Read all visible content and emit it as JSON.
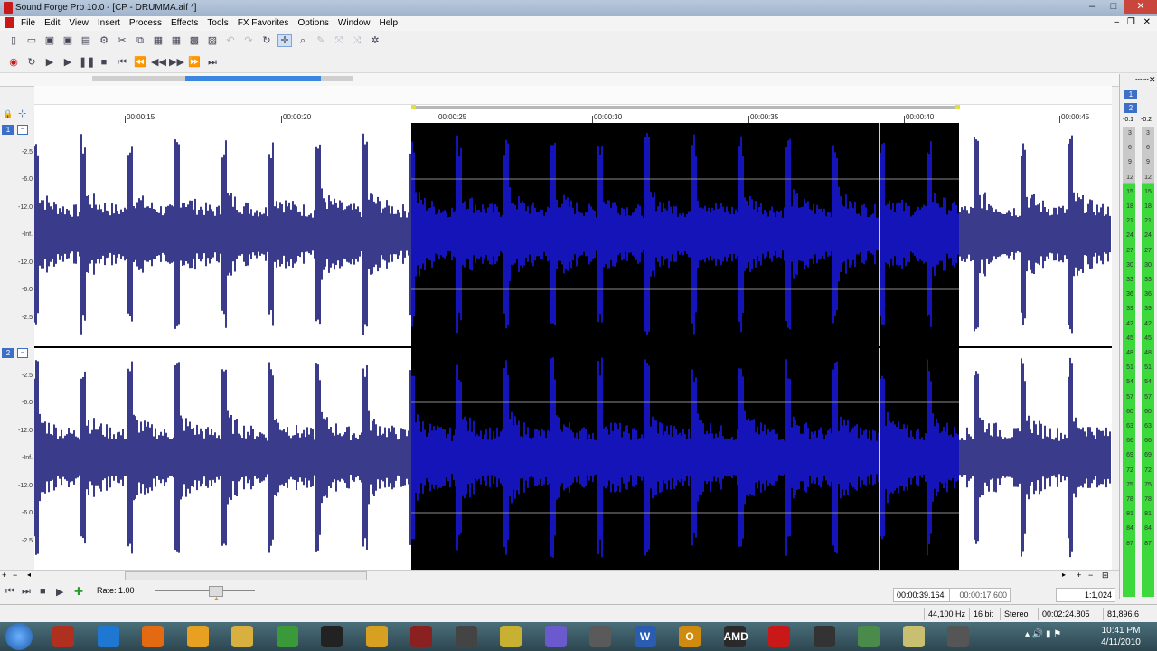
{
  "window": {
    "title": "Sound Forge Pro 10.0 - [CP - DRUMMA.aif *]",
    "controls": {
      "minimize": "–",
      "maximize": "□",
      "close": "✕",
      "restore": "❐"
    }
  },
  "menu": [
    "File",
    "Edit",
    "View",
    "Insert",
    "Process",
    "Effects",
    "Tools",
    "FX Favorites",
    "Options",
    "Window",
    "Help"
  ],
  "toolbar_icons": [
    "new-icon",
    "open-icon",
    "save-icon",
    "save-as-icon",
    "render-icon",
    "properties-icon",
    "cut-icon",
    "copy-icon",
    "paste-icon",
    "paste-special-icon",
    "mix-icon",
    "crop-icon",
    "undo-icon",
    "redo-icon",
    "repeat-icon",
    "edit-tool-icon",
    "magnify-tool-icon",
    "pencil-tool-icon",
    "envelope-tool-icon",
    "event-tool-icon",
    "plugin-chain-icon"
  ],
  "transport_icons": [
    "record-icon",
    "loop-icon",
    "play-all-icon",
    "play-icon",
    "pause-icon",
    "stop-icon",
    "go-to-start-icon",
    "previous-icon",
    "rewind-icon",
    "forward-icon",
    "next-icon",
    "go-to-end-icon"
  ],
  "ruler": {
    "ticks": [
      "00:00:15",
      "00:00:20",
      "00:00:25",
      "00:00:30",
      "00:00:35",
      "00:00:40",
      "00:00:45"
    ]
  },
  "channels": [
    {
      "badge": "1",
      "minimize": "−",
      "db_labels": [
        "-2.5",
        "-6.0",
        "-12.0",
        "-Inf.",
        "-12.0",
        "-6.0",
        "-2.5"
      ]
    },
    {
      "badge": "2",
      "minimize": "−",
      "db_labels": [
        "-2.5",
        "-6.0",
        "-12.0",
        "-Inf.",
        "-12.0",
        "-6.0",
        "-2.5"
      ]
    }
  ],
  "meter": {
    "channel_buttons": [
      "1",
      "2"
    ],
    "peaks": [
      "-0.1",
      "-0.2"
    ],
    "scale": [
      "3",
      "6",
      "9",
      "12",
      "15",
      "18",
      "21",
      "24",
      "27",
      "30",
      "33",
      "36",
      "39",
      "42",
      "45",
      "48",
      "51",
      "54",
      "57",
      "60",
      "63",
      "66",
      "69",
      "72",
      "75",
      "78",
      "81",
      "84",
      "87"
    ],
    "colors": {
      "top": "#c9c9c9",
      "green": "#3cd83c"
    }
  },
  "bottom_transport": {
    "rate_label": "Rate: 1.00"
  },
  "status_fields": {
    "cursor_position": "00:00:39.164",
    "selection_length": "00:00:17.600",
    "zoom_ratio": "1:1,024"
  },
  "statusbar": {
    "sample_rate": "44,100 Hz",
    "bit_depth": "16 bit",
    "channels": "Stereo",
    "length": "00:02:24.805",
    "disk_space": "81,896.6 MB"
  },
  "taskbar": {
    "apps": [
      "media-player-icon",
      "internet-explorer-icon",
      "firefox-icon",
      "pinwheel-app-icon",
      "explorer-folder-icon",
      "chrome-icon",
      "blackberry-icon",
      "video-player-icon",
      "soundforge-taskbar-icon",
      "ableton-icon",
      "reason-icon",
      "fl-studio-icon",
      "acid-icon",
      "word-icon",
      "outlook-icon",
      "amd-icon",
      "opera-icon",
      "audacity-icon",
      "network-icon",
      "notepad-icon",
      "wire-icon"
    ],
    "app_labels": {
      "word": "W",
      "outlook": "O",
      "amd": "AMD"
    },
    "time": "10:41 PM",
    "date": "4/11/2010"
  },
  "colors": {
    "waveform_unselected": "#0a0a6e",
    "waveform_selected": "#1a1ae6",
    "selection_background": "#000000",
    "overview_thumb": "#3b86e0"
  }
}
